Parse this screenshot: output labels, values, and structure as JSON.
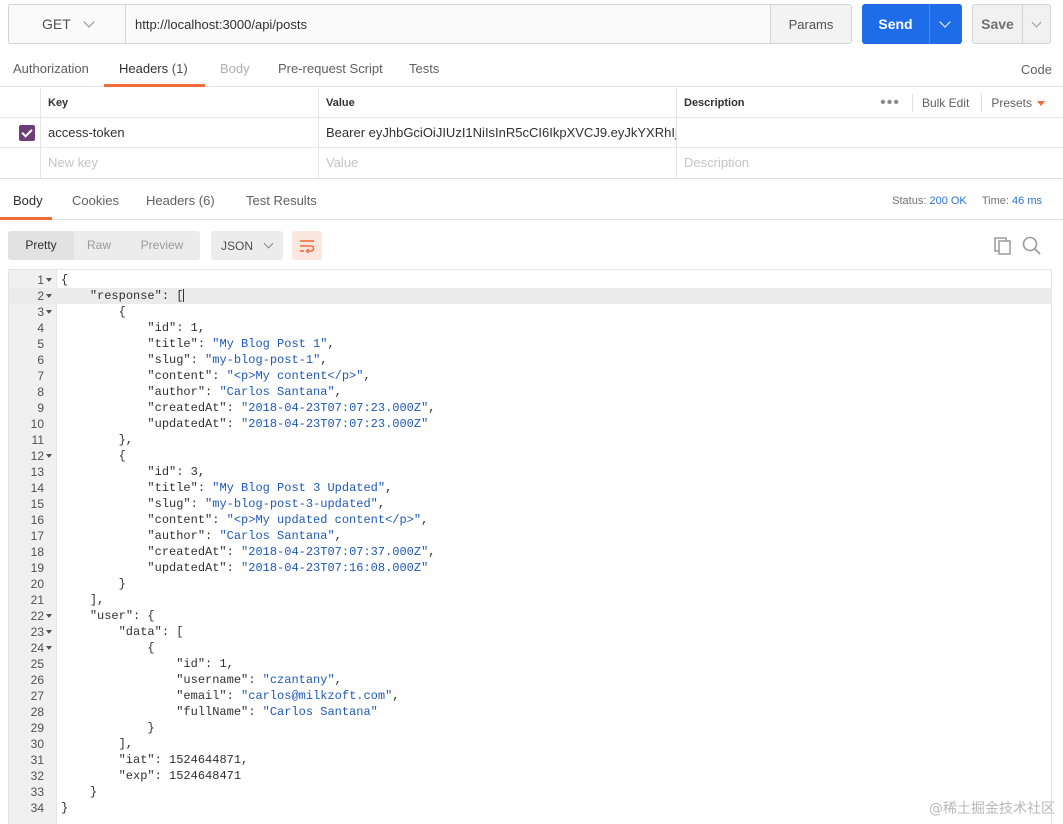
{
  "request": {
    "method": "GET",
    "url": "http://localhost:3000/api/posts",
    "params_label": "Params",
    "send_label": "Send",
    "save_label": "Save"
  },
  "request_tabs": {
    "authorization": "Authorization",
    "headers": "Headers",
    "headers_count": "(1)",
    "body": "Body",
    "prerequest": "Pre-request Script",
    "tests": "Tests",
    "code": "Code"
  },
  "headers_table": {
    "col_key": "Key",
    "col_value": "Value",
    "col_description": "Description",
    "bulk_edit": "Bulk Edit",
    "presets": "Presets",
    "rows": [
      {
        "key": "access-token",
        "value": "Bearer eyJhbGciOiJIUzI1NiIsInR5cCI6IkpXVCJ9.eyJkYXRhIjpbe...",
        "description": "",
        "enabled": true
      }
    ],
    "new_key_placeholder": "New key",
    "value_placeholder": "Value",
    "description_placeholder": "Description"
  },
  "response_tabs": {
    "body": "Body",
    "cookies": "Cookies",
    "headers": "Headers",
    "headers_count": "(6)",
    "test_results": "Test Results",
    "status_label": "Status:",
    "status_value": "200 OK",
    "time_label": "Time:",
    "time_value": "46 ms"
  },
  "response_toolbar": {
    "pretty": "Pretty",
    "raw": "Raw",
    "preview": "Preview",
    "format": "JSON"
  },
  "code_lines": [
    {
      "n": "1",
      "fold": true,
      "html": "<span class='p'>{</span>"
    },
    {
      "n": "2",
      "fold": true,
      "hl": true,
      "html": "    <span class='k'>\"response\"</span><span class='p'>: [</span><span class='cursor'></span>"
    },
    {
      "n": "3",
      "fold": true,
      "html": "        <span class='p'>{</span>"
    },
    {
      "n": "4",
      "html": "            <span class='k'>\"id\"</span><span class='p'>: </span><span class='n'>1</span><span class='p'>,</span>"
    },
    {
      "n": "5",
      "html": "            <span class='k'>\"title\"</span><span class='p'>: </span><span class='s'>\"My Blog Post 1\"</span><span class='p'>,</span>"
    },
    {
      "n": "6",
      "html": "            <span class='k'>\"slug\"</span><span class='p'>: </span><span class='s'>\"my-blog-post-1\"</span><span class='p'>,</span>"
    },
    {
      "n": "7",
      "html": "            <span class='k'>\"content\"</span><span class='p'>: </span><span class='s'>\"&lt;p&gt;My content&lt;/p&gt;\"</span><span class='p'>,</span>"
    },
    {
      "n": "8",
      "html": "            <span class='k'>\"author\"</span><span class='p'>: </span><span class='s'>\"Carlos Santana\"</span><span class='p'>,</span>"
    },
    {
      "n": "9",
      "html": "            <span class='k'>\"createdAt\"</span><span class='p'>: </span><span class='s'>\"2018-04-23T07:07:23.000Z\"</span><span class='p'>,</span>"
    },
    {
      "n": "10",
      "html": "            <span class='k'>\"updatedAt\"</span><span class='p'>: </span><span class='s'>\"2018-04-23T07:07:23.000Z\"</span>"
    },
    {
      "n": "11",
      "html": "        <span class='p'>},</span>"
    },
    {
      "n": "12",
      "fold": true,
      "html": "        <span class='p'>{</span>"
    },
    {
      "n": "13",
      "html": "            <span class='k'>\"id\"</span><span class='p'>: </span><span class='n'>3</span><span class='p'>,</span>"
    },
    {
      "n": "14",
      "html": "            <span class='k'>\"title\"</span><span class='p'>: </span><span class='s'>\"My Blog Post 3 Updated\"</span><span class='p'>,</span>"
    },
    {
      "n": "15",
      "html": "            <span class='k'>\"slug\"</span><span class='p'>: </span><span class='s'>\"my-blog-post-3-updated\"</span><span class='p'>,</span>"
    },
    {
      "n": "16",
      "html": "            <span class='k'>\"content\"</span><span class='p'>: </span><span class='s'>\"&lt;p&gt;My updated content&lt;/p&gt;\"</span><span class='p'>,</span>"
    },
    {
      "n": "17",
      "html": "            <span class='k'>\"author\"</span><span class='p'>: </span><span class='s'>\"Carlos Santana\"</span><span class='p'>,</span>"
    },
    {
      "n": "18",
      "html": "            <span class='k'>\"createdAt\"</span><span class='p'>: </span><span class='s'>\"2018-04-23T07:07:37.000Z\"</span><span class='p'>,</span>"
    },
    {
      "n": "19",
      "html": "            <span class='k'>\"updatedAt\"</span><span class='p'>: </span><span class='s'>\"2018-04-23T07:16:08.000Z\"</span>"
    },
    {
      "n": "20",
      "html": "        <span class='p'>}</span>"
    },
    {
      "n": "21",
      "html": "    <span class='p'>],</span>"
    },
    {
      "n": "22",
      "fold": true,
      "html": "    <span class='k'>\"user\"</span><span class='p'>: {</span>"
    },
    {
      "n": "23",
      "fold": true,
      "html": "        <span class='k'>\"data\"</span><span class='p'>: [</span>"
    },
    {
      "n": "24",
      "fold": true,
      "html": "            <span class='p'>{</span>"
    },
    {
      "n": "25",
      "html": "                <span class='k'>\"id\"</span><span class='p'>: </span><span class='n'>1</span><span class='p'>,</span>"
    },
    {
      "n": "26",
      "html": "                <span class='k'>\"username\"</span><span class='p'>: </span><span class='s'>\"czantany\"</span><span class='p'>,</span>"
    },
    {
      "n": "27",
      "html": "                <span class='k'>\"email\"</span><span class='p'>: </span><span class='s'>\"carlos@milkzoft.com\"</span><span class='p'>,</span>"
    },
    {
      "n": "28",
      "html": "                <span class='k'>\"fullName\"</span><span class='p'>: </span><span class='s'>\"Carlos Santana\"</span>"
    },
    {
      "n": "29",
      "html": "            <span class='p'>}</span>"
    },
    {
      "n": "30",
      "html": "        <span class='p'>],</span>"
    },
    {
      "n": "31",
      "html": "        <span class='k'>\"iat\"</span><span class='p'>: </span><span class='n'>1524644871</span><span class='p'>,</span>"
    },
    {
      "n": "32",
      "html": "        <span class='k'>\"exp\"</span><span class='p'>: </span><span class='n'>1524648471</span>"
    },
    {
      "n": "33",
      "html": "    <span class='p'>}</span>"
    },
    {
      "n": "34",
      "html": "<span class='p'>}</span>"
    }
  ],
  "watermark": "@稀土掘金技术社区",
  "colors": {
    "accent": "#f26b3a",
    "send": "#1f6ce8",
    "checkbox": "#6d3e78",
    "json_string": "#1e59b8"
  }
}
